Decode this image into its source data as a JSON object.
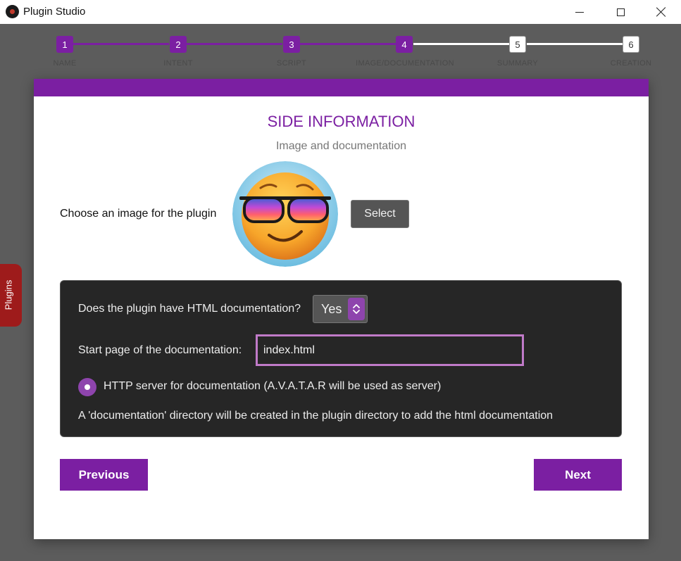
{
  "window": {
    "title": "Plugin Studio",
    "icon": "app-logo-icon",
    "controls": [
      "minimize-icon",
      "maximize-icon",
      "close-icon"
    ]
  },
  "stepper": {
    "steps": [
      {
        "number": "1",
        "label": "NAME",
        "state": "done"
      },
      {
        "number": "2",
        "label": "INTENT",
        "state": "done"
      },
      {
        "number": "3",
        "label": "SCRIPT",
        "state": "done"
      },
      {
        "number": "4",
        "label": "IMAGE/DOCUMENTATION",
        "state": "done"
      },
      {
        "number": "5",
        "label": "SUMMARY",
        "state": "todo"
      },
      {
        "number": "6",
        "label": "CREATION",
        "state": "todo"
      }
    ],
    "colors": {
      "done": "#7b1fa2",
      "todo": "#ffffff"
    }
  },
  "card": {
    "title": "SIDE INFORMATION",
    "subtitle": "Image and documentation",
    "image_label": "Choose an image for the plugin",
    "select_label": "Select",
    "doc_panel": {
      "html_doc_question": "Does the plugin have HTML documentation?",
      "html_doc_value": "Yes",
      "start_page_label": "Start page of the documentation:",
      "start_page_value": "index.html",
      "http_server_label": "HTTP server for documentation (A.V.A.T.A.R will be used as server)",
      "http_server_checked": true,
      "info": "A 'documentation' directory will be created in the plugin directory to add the html documentation"
    },
    "previous_label": "Previous",
    "next_label": "Next"
  },
  "side_tab": {
    "label": "Plugins"
  },
  "colors": {
    "accent": "#7b1fa2",
    "side_tab": "#9e1b1b",
    "panel": "#262626"
  }
}
